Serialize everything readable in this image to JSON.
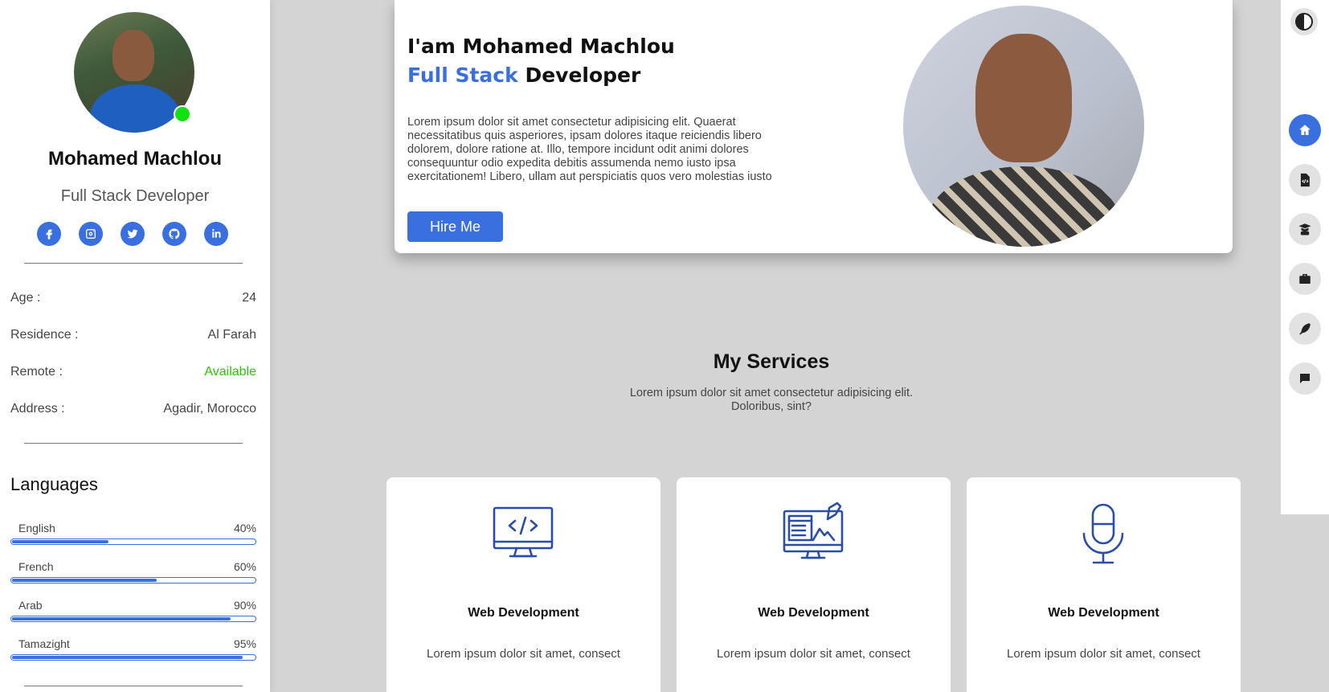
{
  "profile": {
    "name": "Mohamed Machlou",
    "role": "Full Stack Developer",
    "status_color": "#11e011"
  },
  "socials": [
    "facebook-icon",
    "instagram-icon",
    "twitter-icon",
    "github-icon",
    "linkedin-icon"
  ],
  "info": [
    {
      "label": "Age :",
      "value": "24"
    },
    {
      "label": "Residence :",
      "value": "Al Farah"
    },
    {
      "label": "Remote :",
      "value": "Available"
    },
    {
      "label": "Address :",
      "value": "Agadir, Morocco"
    }
  ],
  "languages": {
    "title": "Languages",
    "items": [
      {
        "name": "English",
        "percent_label": "40%",
        "level": 0.4
      },
      {
        "name": "French",
        "percent_label": "60%",
        "level": 0.6
      },
      {
        "name": "Arab",
        "percent_label": "90%",
        "level": 0.9
      },
      {
        "name": "Tamazight",
        "percent_label": "95%",
        "level": 0.95
      }
    ]
  },
  "hero": {
    "intro": "I'am Mohamed Machlou",
    "role_accent": "Full Stack",
    "role_rest": " Developer",
    "description": "Lorem ipsum dolor sit amet consectetur adipisicing elit. Quaerat necessitatibus quis asperiores, ipsam dolores itaque reiciendis libero dolorem, dolore ratione at. Illo, tempore incidunt odit animi dolores consequuntur odio expedita debitis assumenda nemo iusto ipsa exercitationem! Libero, ullam aut perspiciatis quos vero molestias iusto",
    "hire_label": "Hire Me"
  },
  "services": {
    "title": "My Services",
    "subtitle": "Lorem ipsum dolor sit amet consectetur adipisicing elit. Doloribus, sint?",
    "cards": [
      {
        "icon": "code-monitor-icon",
        "title": "Web Development",
        "text": "Lorem ipsum dolor sit amet, consect"
      },
      {
        "icon": "design-monitor-icon",
        "title": "Web Development",
        "text": "Lorem ipsum dolor sit amet, consect"
      },
      {
        "icon": "microphone-icon",
        "title": "Web Development",
        "text": "Lorem ipsum dolor sit amet, consect"
      }
    ]
  },
  "nav": {
    "theme_icon": "theme-toggle-icon",
    "items": [
      "home-icon",
      "code-file-icon",
      "graduation-icon",
      "briefcase-icon",
      "feather-icon",
      "chat-icon"
    ],
    "active": "home-icon"
  },
  "colors": {
    "accent": "#3a6fe0",
    "available": "#2fc000",
    "background": "#d4d4d4"
  }
}
